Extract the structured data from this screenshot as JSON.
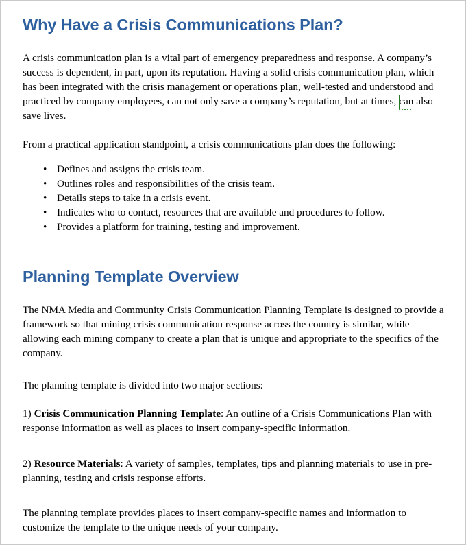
{
  "document": {
    "accent_color": "#2e5f9e",
    "text_color": "#000000",
    "background_color": "#ffffff",
    "border_color": "#c9c9c9",
    "spellcheck_underline_color": "#137a13"
  },
  "sections": [
    {
      "heading": "Why Have a Crisis Communications Plan?",
      "paragraph_intro_a": "A crisis communication plan is a vital part of emergency preparedness and response.  A company’s success is dependent, in part, upon its reputation.  Having a solid crisis communication plan, which has been integrated with the crisis management or operations plan, well-tested and understood and practiced by company employees, can not only save a company’s reputation, but at times, ",
      "paragraph_intro_misspelled": "can",
      "paragraph_intro_b": " also save lives.",
      "paragraph_practical": "From a practical application standpoint, a crisis communications plan does the following:",
      "bullet_marker": "•",
      "bullets": [
        "Defines and assigns the crisis team.",
        "Outlines roles and responsibilities of the crisis team.",
        "Details steps to take in a crisis event.",
        "Indicates who to contact, resources that are available and procedures to follow.",
        "Provides a platform for training, testing and improvement."
      ]
    },
    {
      "heading": "Planning Template Overview",
      "paragraph_nma": "The NMA Media and Community Crisis Communication Planning Template is designed to provide a framework so that mining crisis communication response across the country is similar, while allowing each mining company to create a plan that is unique and appropriate to the specifics of the company.",
      "paragraph_divided": "The planning template is divided into two major sections:",
      "item_1": {
        "number": "1) ",
        "title": "Crisis Communication Planning Template",
        "body": ": An outline of a Crisis Communications Plan with response information as well as places to insert company-specific information."
      },
      "item_2": {
        "number": "2) ",
        "title": "Resource Materials",
        "body": ": A variety of samples, templates, tips and planning materials to use in pre-planning, testing and crisis response efforts."
      },
      "paragraph_closing": "The planning template provides places to insert company-specific names and information to customize the  template to the unique needs of your company."
    }
  ]
}
